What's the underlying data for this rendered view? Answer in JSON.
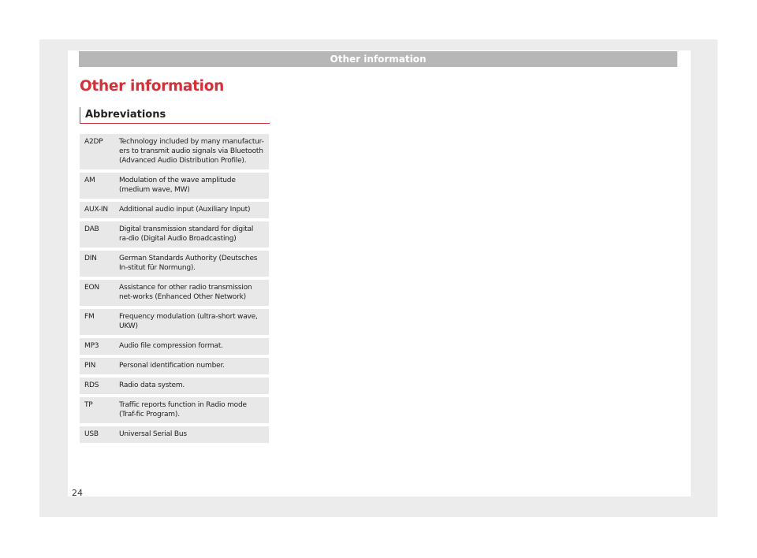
{
  "header": {
    "section_label": "Other information"
  },
  "title": "Other information",
  "section": "Abbreviations",
  "rows": [
    {
      "abbr": "A2DP",
      "desc": "Technology included by many manufactur-ers to transmit audio signals via Bluetooth (Advanced Audio Distribution Profile)."
    },
    {
      "abbr": "AM",
      "desc": "Modulation of the wave amplitude (medium wave, MW)"
    },
    {
      "abbr": "AUX-IN",
      "desc": "Additional audio input (Auxiliary Input)"
    },
    {
      "abbr": "DAB",
      "desc": "Digital transmission standard for digital ra-dio (Digital Audio Broadcasting)"
    },
    {
      "abbr": "DIN",
      "desc": "German Standards Authority (Deutsches In-stitut für Normung)."
    },
    {
      "abbr": "EON",
      "desc": "Assistance for other radio transmission net-works (Enhanced Other Network)"
    },
    {
      "abbr": "FM",
      "desc": "Frequency modulation (ultra-short wave, UKW)"
    },
    {
      "abbr": "MP3",
      "desc": "Audio file compression format."
    },
    {
      "abbr": "PIN",
      "desc": "Personal identification number."
    },
    {
      "abbr": "RDS",
      "desc": "Radio data system."
    },
    {
      "abbr": "TP",
      "desc": "Traffic reports function in Radio mode (Traf-fic Program)."
    },
    {
      "abbr": "USB",
      "desc": "Universal Serial Bus"
    }
  ],
  "page_number": "24",
  "colors": {
    "accent": "#d3313a",
    "header_bar": "#b7b7b7",
    "row_bg": "#e8e8e8",
    "frame": "#ececec"
  }
}
